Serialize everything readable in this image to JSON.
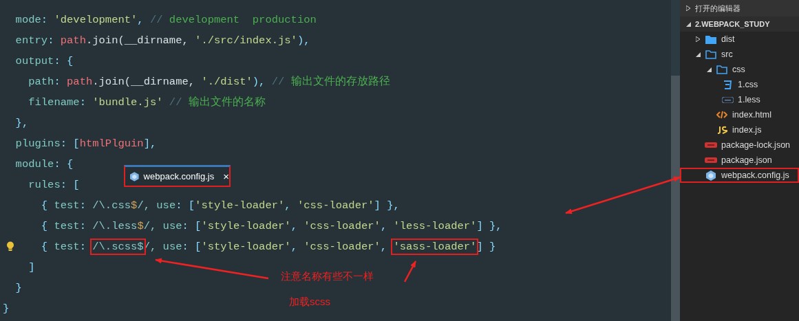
{
  "editor": {
    "lines": [
      {
        "tokens": [
          {
            "t": "  mode",
            "kind": "key"
          },
          {
            "t": ": ",
            "kind": "punct"
          },
          {
            "t": "'development'",
            "kind": "str"
          },
          {
            "t": ", ",
            "kind": "punct"
          },
          {
            "t": "// ",
            "kind": "slash"
          },
          {
            "t": "development  production",
            "kind": "comment"
          }
        ]
      },
      {
        "tokens": [
          {
            "t": "  entry",
            "kind": "key"
          },
          {
            "t": ": ",
            "kind": "punct"
          },
          {
            "t": "path",
            "kind": "var"
          },
          {
            "t": ".join(__dirname, ",
            "kind": "plain"
          },
          {
            "t": "'./src/index.js'",
            "kind": "str"
          },
          {
            "t": "),",
            "kind": "punct"
          }
        ]
      },
      {
        "tokens": [
          {
            "t": "  output",
            "kind": "key"
          },
          {
            "t": ": {",
            "kind": "punct"
          }
        ]
      },
      {
        "tokens": [
          {
            "t": "    path",
            "kind": "key"
          },
          {
            "t": ": ",
            "kind": "punct"
          },
          {
            "t": "path",
            "kind": "var"
          },
          {
            "t": ".join(__dirname, ",
            "kind": "plain"
          },
          {
            "t": "'./dist'",
            "kind": "str"
          },
          {
            "t": "), ",
            "kind": "punct"
          },
          {
            "t": "// ",
            "kind": "slash"
          },
          {
            "t": "输出文件的存放路径",
            "kind": "comment"
          }
        ]
      },
      {
        "tokens": [
          {
            "t": "    filename",
            "kind": "key"
          },
          {
            "t": ": ",
            "kind": "punct"
          },
          {
            "t": "'bundle.js'",
            "kind": "str"
          },
          {
            "t": " // ",
            "kind": "slash"
          },
          {
            "t": "输出文件的名称",
            "kind": "comment"
          }
        ]
      },
      {
        "tokens": [
          {
            "t": "  },",
            "kind": "punct"
          }
        ]
      },
      {
        "tokens": [
          {
            "t": "  plugins",
            "kind": "key"
          },
          {
            "t": ": [",
            "kind": "punct"
          },
          {
            "t": "htmlPlguin",
            "kind": "var"
          },
          {
            "t": "],",
            "kind": "punct"
          }
        ]
      },
      {
        "tokens": [
          {
            "t": "  module",
            "kind": "key"
          },
          {
            "t": ": {",
            "kind": "punct"
          }
        ]
      },
      {
        "tokens": [
          {
            "t": "    rules",
            "kind": "key"
          },
          {
            "t": ": [",
            "kind": "punct"
          }
        ]
      },
      {
        "tokens": [
          {
            "t": "      { ",
            "kind": "punct"
          },
          {
            "t": "test",
            "kind": "key"
          },
          {
            "t": ": ",
            "kind": "punct"
          },
          {
            "t": "/\\.css",
            "kind": "regex"
          },
          {
            "t": "$",
            "kind": "dollar"
          },
          {
            "t": "/, ",
            "kind": "regex"
          },
          {
            "t": "use",
            "kind": "key"
          },
          {
            "t": ": [",
            "kind": "punct"
          },
          {
            "t": "'style-loader'",
            "kind": "str"
          },
          {
            "t": ", ",
            "kind": "punct"
          },
          {
            "t": "'css-loader'",
            "kind": "str"
          },
          {
            "t": "] },",
            "kind": "punct"
          }
        ]
      },
      {
        "tokens": [
          {
            "t": "      { ",
            "kind": "punct"
          },
          {
            "t": "test",
            "kind": "key"
          },
          {
            "t": ": ",
            "kind": "punct"
          },
          {
            "t": "/\\.less",
            "kind": "regex"
          },
          {
            "t": "$",
            "kind": "dollar"
          },
          {
            "t": "/, ",
            "kind": "regex"
          },
          {
            "t": "use",
            "kind": "key"
          },
          {
            "t": ": [",
            "kind": "punct"
          },
          {
            "t": "'style-loader'",
            "kind": "str"
          },
          {
            "t": ", ",
            "kind": "punct"
          },
          {
            "t": "'css-loader'",
            "kind": "str"
          },
          {
            "t": ", ",
            "kind": "punct"
          },
          {
            "t": "'less-loader'",
            "kind": "str"
          },
          {
            "t": "] },",
            "kind": "punct"
          }
        ]
      },
      {
        "lightbulb": true,
        "tokens": [
          {
            "t": "      { ",
            "kind": "punct"
          },
          {
            "t": "test",
            "kind": "key"
          },
          {
            "t": ": ",
            "kind": "punct"
          },
          {
            "t": "/\\.scss$",
            "kind": "regex",
            "boxed": true
          },
          {
            "t": "/, ",
            "kind": "regex"
          },
          {
            "t": "use",
            "kind": "key"
          },
          {
            "t": ": [",
            "kind": "punct"
          },
          {
            "t": "'style-loader'",
            "kind": "str"
          },
          {
            "t": ", ",
            "kind": "punct"
          },
          {
            "t": "'css-loader'",
            "kind": "str"
          },
          {
            "t": ", ",
            "kind": "punct"
          },
          {
            "t": "'sass-loader'",
            "kind": "str",
            "boxed": true
          },
          {
            "t": "] }",
            "kind": "punct"
          }
        ]
      },
      {
        "tokens": [
          {
            "t": "    ]",
            "kind": "punct"
          }
        ]
      },
      {
        "tokens": [
          {
            "t": "  }",
            "kind": "punct"
          }
        ]
      },
      {
        "tokens": [
          {
            "t": "}",
            "kind": "punct"
          }
        ]
      }
    ]
  },
  "drag_tab": {
    "label": "webpack.config.js",
    "close": "×"
  },
  "notes": [
    "注意名称有些不一样",
    "加载scss"
  ],
  "explorer": {
    "sections": [
      {
        "label": "打开的编辑器",
        "expanded": false
      },
      {
        "label": "2.WEBPACK_STUDY",
        "expanded": true
      }
    ],
    "tree": [
      {
        "name": "dist",
        "kind": "folder",
        "expanded": false
      },
      {
        "name": "src",
        "kind": "folder",
        "expanded": true,
        "children": [
          {
            "name": "css",
            "kind": "folder",
            "expanded": true,
            "children": [
              {
                "name": "1.css",
                "kind": "css"
              },
              {
                "name": "1.less",
                "kind": "less"
              }
            ]
          },
          {
            "name": "index.html",
            "kind": "html"
          },
          {
            "name": "index.js",
            "kind": "js"
          }
        ]
      },
      {
        "name": "package-lock.json",
        "kind": "npm"
      },
      {
        "name": "package.json",
        "kind": "npm"
      },
      {
        "name": "webpack.config.js",
        "kind": "webpack",
        "marked": true
      }
    ]
  }
}
